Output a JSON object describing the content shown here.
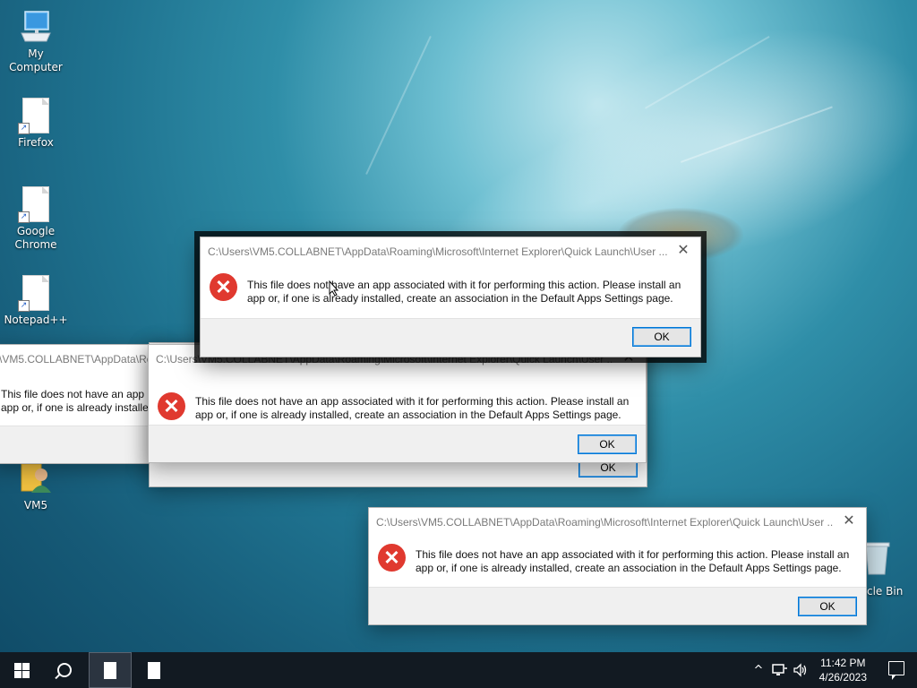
{
  "desktop": {
    "icons": [
      {
        "label": "My Computer"
      },
      {
        "label": "Firefox"
      },
      {
        "label": "Google Chrome"
      },
      {
        "label": "Notepad++"
      },
      {
        "label": "VM5"
      },
      {
        "label": "Recycle Bin",
        "visible_label": "cle Bin"
      }
    ]
  },
  "dialogs": [
    {
      "title": "C:\\Users\\VM5.COLLABNET\\AppData\\Roaming\\Microsoft\\Internet Explorer\\Quick Launch\\User ...",
      "message": "This file does not have an app associated with it for performing this action. Please install an app or, if one is already installed, create an association in the Default Apps Settings page.",
      "ok": "OK",
      "close": "✕"
    },
    {
      "title": "\\VM5.COLLABNET\\AppData\\Ro",
      "message_line1": "This file does not have an app a",
      "message_line2": "app or, if one is already installed",
      "ok": "OK"
    },
    {
      "title": "C:\\Users\\VM5.COLLABNET\\AppData\\Roaming\\Microsoft\\Internet Explorer\\Quick Launch\\User ...",
      "message": "This file does not have an app associated with it for performing this action. Please install an app or, if one is already installed, create an association in the Default Apps Settings page.",
      "ok": "OK",
      "ok_behind": "OK",
      "close": "✕"
    },
    {
      "title": "C:\\Users\\VM5.COLLABNET\\AppData\\Roaming\\Microsoft\\Internet Explorer\\Quick Launch\\User ...",
      "message": "This file does not have an app associated with it for performing this action. Please install an app or, if one is already installed, create an association in the Default Apps Settings page.",
      "ok": "OK",
      "close": "✕"
    }
  ],
  "taskbar": {
    "start_icon": "windows-logo-icon",
    "search_icon": "search-icon",
    "clock_time": "11:42 PM",
    "clock_date": "4/26/2023",
    "tray_chevron": "^"
  },
  "colors": {
    "error_red": "#e0392f",
    "button_focus_blue": "#0078d7",
    "taskbar": "#121a22"
  }
}
